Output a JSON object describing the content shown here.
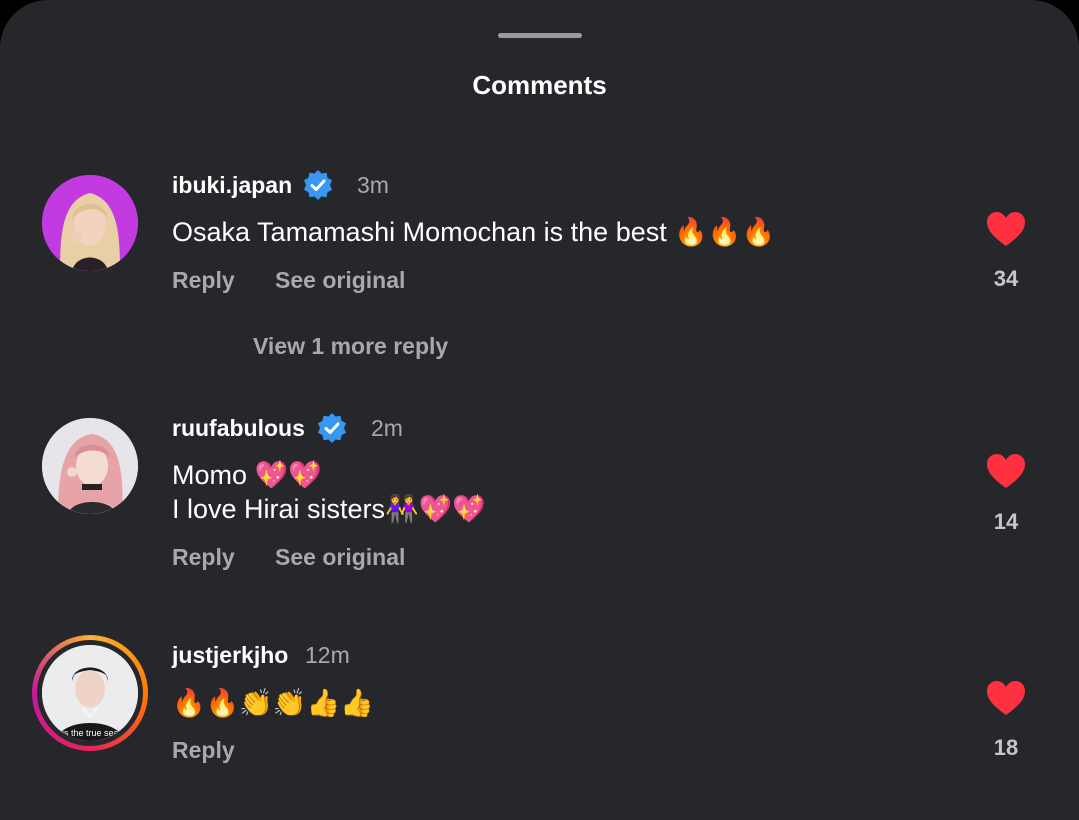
{
  "sheet": {
    "title": "Comments"
  },
  "comments": [
    {
      "username": "ibuki.japan",
      "time": "3m",
      "text_lines": [
        "Osaka Tamamashi Momochan is the best 🔥🔥🔥"
      ],
      "reply_label": "Reply",
      "see_original_label": "See original",
      "likes": "34",
      "view_more_replies": "View 1 more reply"
    },
    {
      "username": "ruufabulous",
      "time": "2m",
      "text_lines": [
        "Momo 💖💖",
        "I love Hirai sisters👭💖💖"
      ],
      "reply_label": "Reply",
      "see_original_label": "See original",
      "likes": "14"
    },
    {
      "username": "justjerkjho",
      "time": "12m",
      "text_lines": [
        "🔥🔥👏👏👍👍"
      ],
      "reply_label": "Reply",
      "likes": "18",
      "avatar_shirt_text": "is the true sea"
    }
  ],
  "colors": {
    "background": "#26272b",
    "verified": "#3897f0",
    "heart": "#ff3040",
    "secondary_text": "#a8a9ad"
  }
}
